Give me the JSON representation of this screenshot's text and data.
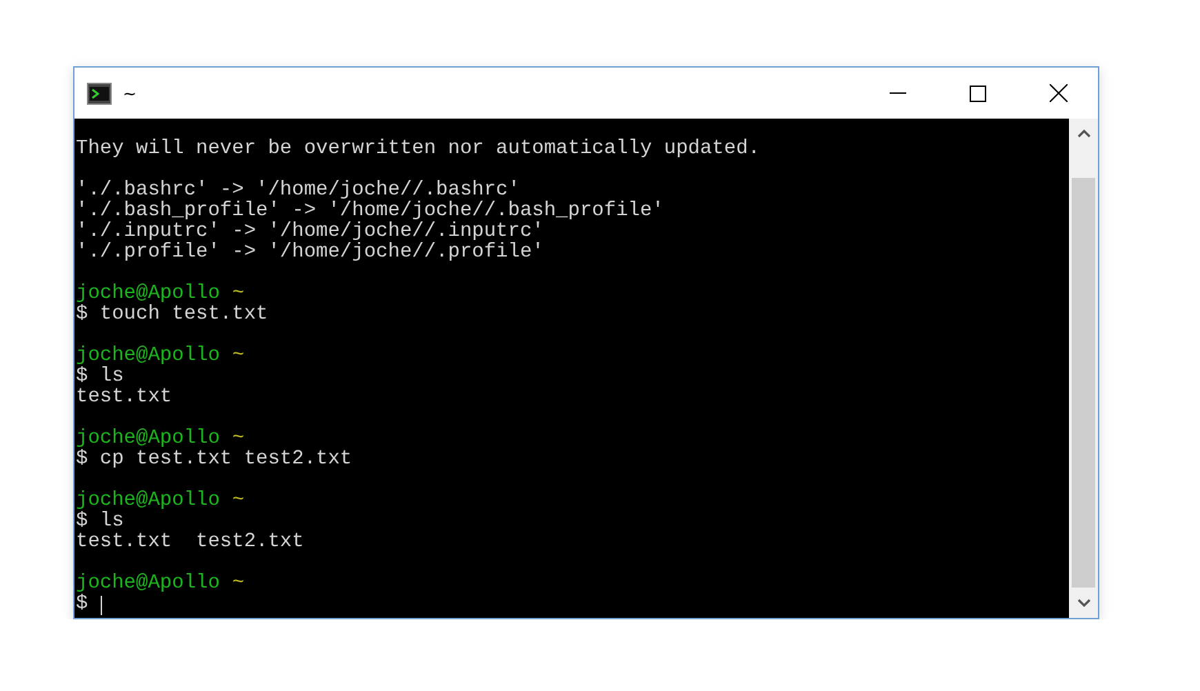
{
  "window": {
    "title": "~"
  },
  "terminal": {
    "lines": [
      {
        "kind": "blank"
      },
      {
        "kind": "output",
        "text": "They will never be overwritten nor automatically updated."
      },
      {
        "kind": "blank"
      },
      {
        "kind": "output",
        "text": "'./.bashrc' -> '/home/joche//.bashrc'"
      },
      {
        "kind": "output",
        "text": "'./.bash_profile' -> '/home/joche//.bash_profile'"
      },
      {
        "kind": "output",
        "text": "'./.inputrc' -> '/home/joche//.inputrc'"
      },
      {
        "kind": "output",
        "text": "'./.profile' -> '/home/joche//.profile'"
      },
      {
        "kind": "blank"
      },
      {
        "kind": "prompt",
        "user": "joche@Apollo",
        "path": "~"
      },
      {
        "kind": "command",
        "text": "$ touch test.txt",
        "cursor": false
      },
      {
        "kind": "blank"
      },
      {
        "kind": "prompt",
        "user": "joche@Apollo",
        "path": "~"
      },
      {
        "kind": "command",
        "text": "$ ls",
        "cursor": false
      },
      {
        "kind": "output",
        "text": "test.txt"
      },
      {
        "kind": "blank"
      },
      {
        "kind": "prompt",
        "user": "joche@Apollo",
        "path": "~"
      },
      {
        "kind": "command",
        "text": "$ cp test.txt test2.txt",
        "cursor": false
      },
      {
        "kind": "blank"
      },
      {
        "kind": "prompt",
        "user": "joche@Apollo",
        "path": "~"
      },
      {
        "kind": "command",
        "text": "$ ls",
        "cursor": false
      },
      {
        "kind": "output",
        "text": "test.txt  test2.txt"
      },
      {
        "kind": "blank"
      },
      {
        "kind": "prompt",
        "user": "joche@Apollo",
        "path": "~"
      },
      {
        "kind": "command",
        "text": "$",
        "cursor": true
      }
    ]
  }
}
